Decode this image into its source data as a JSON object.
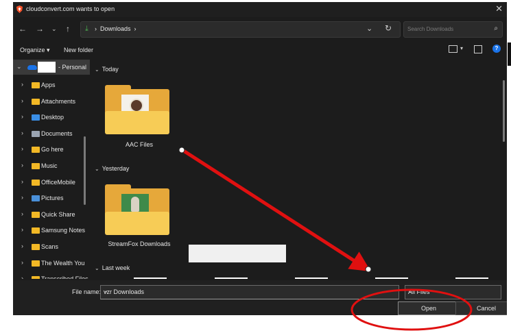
{
  "window": {
    "title": "cloudconvert.com wants to open"
  },
  "nav": {
    "breadcrumb": [
      "Downloads"
    ],
    "search_placeholder": "Search Downloads"
  },
  "toolbar": {
    "organize": "Organize",
    "new_folder": "New folder"
  },
  "sidebar": {
    "onedrive_suffix": "- Personal",
    "items": [
      {
        "label": "Apps",
        "icon": "folder-icon"
      },
      {
        "label": "Attachments",
        "icon": "folder-icon"
      },
      {
        "label": "Desktop",
        "icon": "desktop-icon"
      },
      {
        "label": "Documents",
        "icon": "documents-icon"
      },
      {
        "label": "Go here",
        "icon": "folder-icon"
      },
      {
        "label": "Music",
        "icon": "folder-icon"
      },
      {
        "label": "OfficeMobile",
        "icon": "folder-icon"
      },
      {
        "label": "Pictures",
        "icon": "pictures-icon"
      },
      {
        "label": "Quick Share",
        "icon": "folder-icon"
      },
      {
        "label": "Samsung Notes",
        "icon": "folder-icon"
      },
      {
        "label": "Scans",
        "icon": "folder-icon"
      },
      {
        "label": "The Wealth You",
        "icon": "folder-icon"
      },
      {
        "label": "Transcribed Files",
        "icon": "folder-icon"
      }
    ]
  },
  "groups": {
    "today": "Today",
    "yesterday": "Yesterday",
    "last_week": "Last week"
  },
  "files": {
    "aac": "AAC Files",
    "streamfox": "StreamFox Downloads"
  },
  "bottom": {
    "file_name_label": "File name:",
    "file_name_value": "vzr Downloads",
    "filter": "All Files",
    "open": "Open",
    "cancel": "Cancel"
  },
  "colors": {
    "accent_green": "#4caf50",
    "folder": "#f7cc56",
    "annotation_red": "#e01010"
  }
}
